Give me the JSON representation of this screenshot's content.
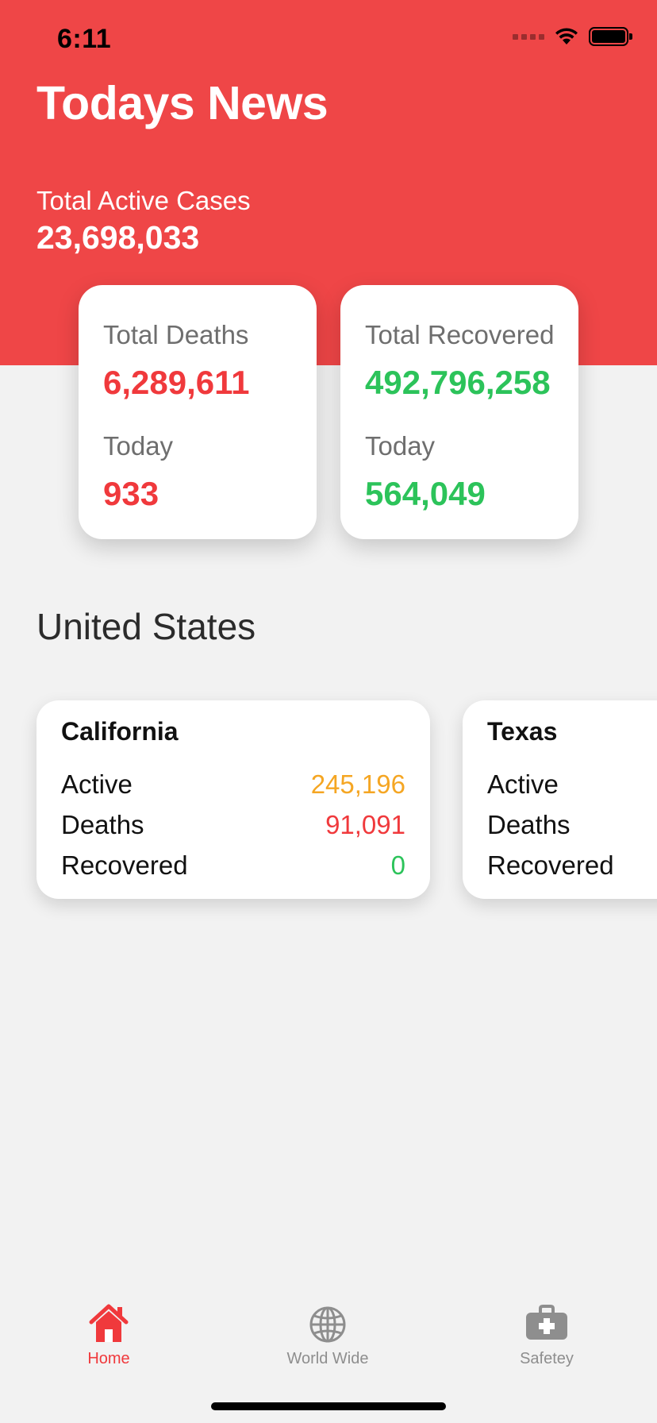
{
  "status_bar": {
    "time": "6:11"
  },
  "header": {
    "title": "Todays News",
    "active_cases_label": "Total Active Cases",
    "active_cases_value": "23,698,033",
    "color": "#ef4647"
  },
  "stats": {
    "deaths": {
      "label": "Total Deaths",
      "value": "6,289,611",
      "today_label": "Today",
      "today_value": "933",
      "color": "#f0393c"
    },
    "recovered": {
      "label": "Total Recovered",
      "value": "492,796,258",
      "today_label": "Today",
      "today_value": "564,049",
      "color": "#2cc35a"
    }
  },
  "section": {
    "title": "United States"
  },
  "states": [
    {
      "name": "California",
      "active_label": "Active",
      "active": "245,196",
      "deaths_label": "Deaths",
      "deaths": "91,091",
      "recovered_label": "Recovered",
      "recovered": "0"
    },
    {
      "name": "Texas",
      "active_label": "Active",
      "deaths_label": "Deaths",
      "recovered_label": "Recovered"
    }
  ],
  "tab_bar": {
    "tabs": [
      {
        "label": "Home",
        "icon": "house-icon",
        "active": true
      },
      {
        "label": "World Wide",
        "icon": "globe-icon",
        "active": false
      },
      {
        "label": "Safetey",
        "icon": "first-aid-kit-icon",
        "active": false
      }
    ],
    "active_color": "#f0393c",
    "inactive_color": "#8e8e8e"
  }
}
